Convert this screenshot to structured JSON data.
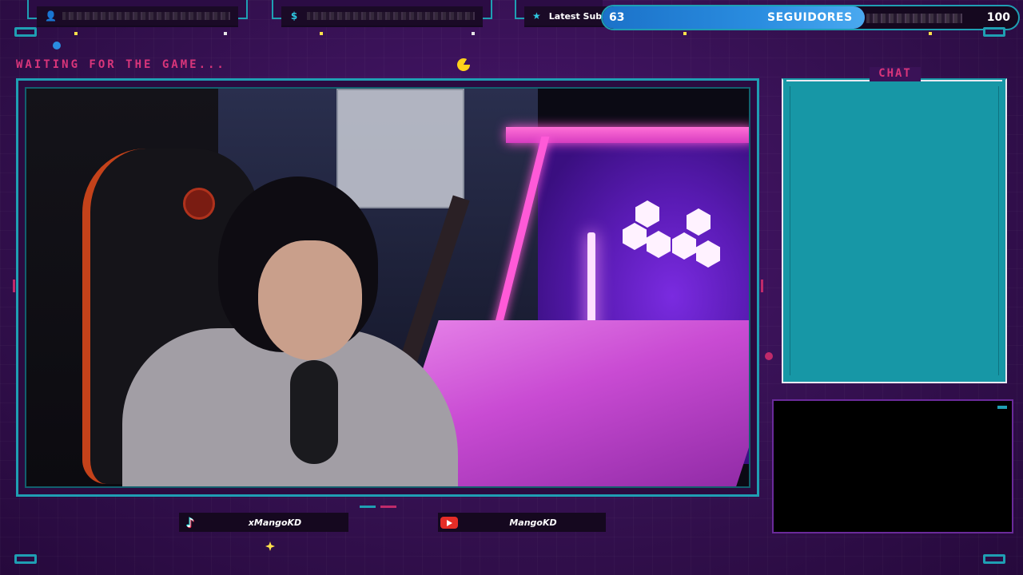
{
  "overlay": {
    "waiting_text": "WAITING FOR THE GAME...",
    "top_slots": [
      {
        "icon": "user-icon",
        "glyph": "👤",
        "text": ""
      },
      {
        "icon": "dollar-icon",
        "glyph": "$",
        "text": ""
      },
      {
        "icon": "star-icon",
        "glyph": "★",
        "text": "Latest Subscrib"
      }
    ],
    "followers": {
      "current": "63",
      "label": "SEGUIDORES",
      "goal": "100",
      "progress_fraction": 0.63
    },
    "chat": {
      "title": "CHAT"
    },
    "social": {
      "tiktok": {
        "icon": "tiktok-icon",
        "handle": "xMangoKD"
      },
      "youtube": {
        "icon": "youtube-icon",
        "handle": "MangoKD"
      }
    },
    "colors": {
      "accent_cyan": "#1f9fb3",
      "accent_pink": "#d8357a",
      "background": "#3a1257",
      "chat_fill": "#1797a6",
      "progress_blue": "#2a8de0"
    }
  }
}
